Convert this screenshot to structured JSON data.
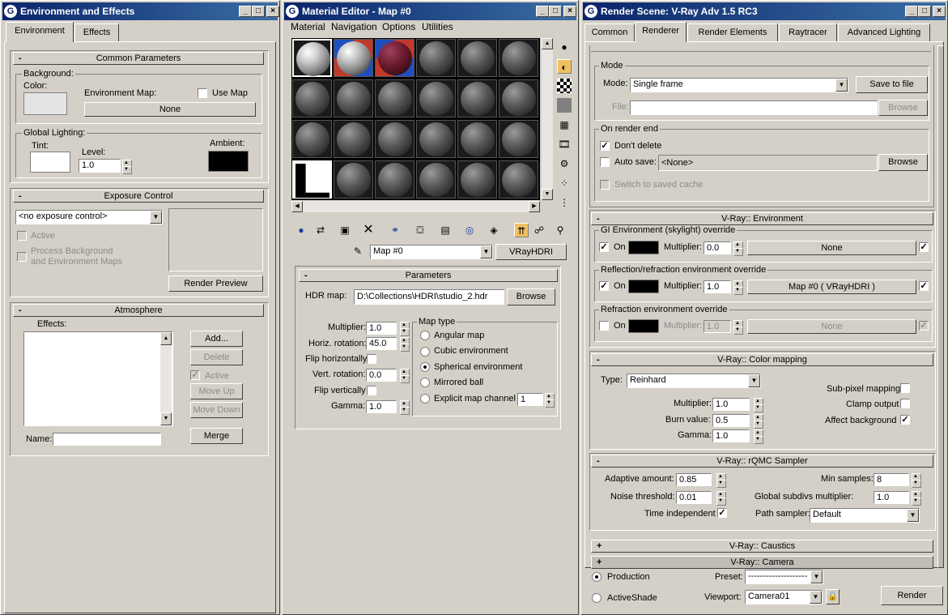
{
  "env": {
    "title": "Environment and Effects",
    "tabs": [
      "Environment",
      "Effects"
    ],
    "common_rollout": "Common Parameters",
    "background_group": "Background:",
    "color_label": "Color:",
    "env_map_label": "Environment Map:",
    "use_map_label": "Use Map",
    "use_map_checked": false,
    "env_map_button": "None",
    "global_lighting": "Global Lighting:",
    "tint_label": "Tint:",
    "level_label": "Level:",
    "level_value": "1.0",
    "ambient_label": "Ambient:",
    "exposure_rollout": "Exposure Control",
    "exposure_select": "<no exposure control>",
    "active_label": "Active",
    "process_bg_label": "Process Background",
    "process_bg_label2": "and Environment Maps",
    "render_preview": "Render Preview",
    "atmosphere_rollout": "Atmosphere",
    "effects_label": "Effects:",
    "add": "Add...",
    "delete": "Delete",
    "active2": "Active",
    "move_up": "Move Up",
    "move_down": "Move Down",
    "name_label": "Name:",
    "name_value": "",
    "merge": "Merge",
    "bg_color": "#e4e4e4",
    "tint_color": "#ffffff",
    "ambient_color": "#000000"
  },
  "mat": {
    "title": "Material Editor - Map #0",
    "menu": [
      "Material",
      "Navigation",
      "Options",
      "Utilities"
    ],
    "map_name": "Map #0",
    "map_type": "VRayHDRI",
    "params_rollout": "Parameters",
    "hdr_map_label": "HDR map:",
    "hdr_map_value": "D:\\Collections\\HDRI\\studio_2.hdr",
    "browse": "Browse",
    "multiplier_label": "Multiplier:",
    "multiplier_value": "1.0",
    "horiz_label": "Horiz. rotation:",
    "horiz_value": "45.0",
    "flip_h_label": "Flip horizontally",
    "vert_label": "Vert. rotation:",
    "vert_value": "0.0",
    "flip_v_label": "Flip vertically",
    "gamma_label": "Gamma:",
    "gamma_value": "1.0",
    "map_type_group": "Map type",
    "map_types": [
      "Angular map",
      "Cubic environment",
      "Spherical environment",
      "Mirrored ball",
      "Explicit map channel"
    ],
    "map_type_selected": 2,
    "channel_value": "1"
  },
  "render": {
    "title": "Render Scene: V-Ray Adv 1.5 RC3",
    "tabs": [
      "Common",
      "Renderer",
      "Render Elements",
      "Raytracer",
      "Advanced Lighting"
    ],
    "selected_tab": 1,
    "mode_group": "Mode",
    "mode_label": "Mode:",
    "mode_value": "Single frame",
    "save_to_file": "Save to file",
    "file_label": "File:",
    "browse": "Browse",
    "on_render_end": "On render end",
    "dont_delete": "Don't delete",
    "auto_save": "Auto save:",
    "auto_save_value": "<None>",
    "browse2": "Browse",
    "switch_cache": "Switch to saved cache",
    "env_rollout": "V-Ray:: Environment",
    "gi_group": "GI Environment (skylight) override",
    "on": "On",
    "multiplier_label": "Multiplier:",
    "gi_multiplier": "0.0",
    "gi_map": "None",
    "refl_group": "Reflection/refraction environment override",
    "refl_multiplier": "1.0",
    "refl_map": "Map #0  ( VRayHDRI )",
    "refr_group": "Refraction environment override",
    "refr_multiplier": "1.0",
    "refr_map": "None",
    "color_rollout": "V-Ray:: Color mapping",
    "type_label": "Type:",
    "type_value": "Reinhard",
    "cm_multiplier": "1.0",
    "burn_label": "Burn value:",
    "burn_value": "0.5",
    "gamma_label": "Gamma:",
    "gamma_value": "1.0",
    "subpixel": "Sub-pixel mapping",
    "clamp": "Clamp output",
    "affect_bg": "Affect background",
    "qmc_rollout": "V-Ray:: rQMC Sampler",
    "adaptive_label": "Adaptive amount:",
    "adaptive_value": "0.85",
    "noise_label": "Noise threshold:",
    "noise_value": "0.01",
    "time_indep": "Time independent",
    "min_samples_label": "Min samples:",
    "min_samples_value": "8",
    "global_subdivs_label": "Global subdivs multiplier:",
    "global_subdivs_value": "1.0",
    "path_sampler_label": "Path sampler:",
    "path_sampler_value": "Default",
    "caustics_rollout": "V-Ray:: Caustics",
    "camera_rollout": "V-Ray:: Camera",
    "production": "Production",
    "activeshade": "ActiveShade",
    "preset_label": "Preset:",
    "preset_value": "--------------------",
    "viewport_label": "Viewport:",
    "viewport_value": "Camera01",
    "render_button": "Render"
  }
}
